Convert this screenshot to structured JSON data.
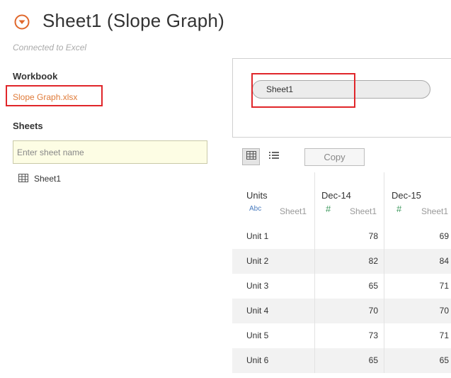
{
  "header": {
    "title": "Sheet1 (Slope Graph)",
    "connection_status": "Connected to Excel",
    "icon": "dropdown-circle-icon",
    "accent_color": "#e0672b"
  },
  "sidebar": {
    "workbook_heading": "Workbook",
    "workbook_file": "Slope Graph.xlsx",
    "sheets_heading": "Sheets",
    "sheet_search_placeholder": "Enter sheet name",
    "sheets": [
      {
        "label": "Sheet1",
        "icon": "table-icon"
      }
    ]
  },
  "canvas": {
    "pill_label": "Sheet1"
  },
  "toolbar": {
    "grid_view_icon": "grid-view-icon",
    "list_view_icon": "list-view-icon",
    "copy_label": "Copy"
  },
  "grid": {
    "columns": [
      {
        "name": "Units",
        "type_label": "Abc",
        "source": "Sheet1"
      },
      {
        "name": "Dec-14",
        "type_label": "#",
        "source": "Sheet1"
      },
      {
        "name": "Dec-15",
        "type_label": "#",
        "source": "Sheet1"
      }
    ],
    "rows": [
      [
        "Unit 1",
        "78",
        "69"
      ],
      [
        "Unit 2",
        "82",
        "84"
      ],
      [
        "Unit 3",
        "65",
        "71"
      ],
      [
        "Unit 4",
        "70",
        "70"
      ],
      [
        "Unit 5",
        "73",
        "71"
      ],
      [
        "Unit 6",
        "65",
        "65"
      ]
    ]
  },
  "highlight_color": "#e0262a"
}
